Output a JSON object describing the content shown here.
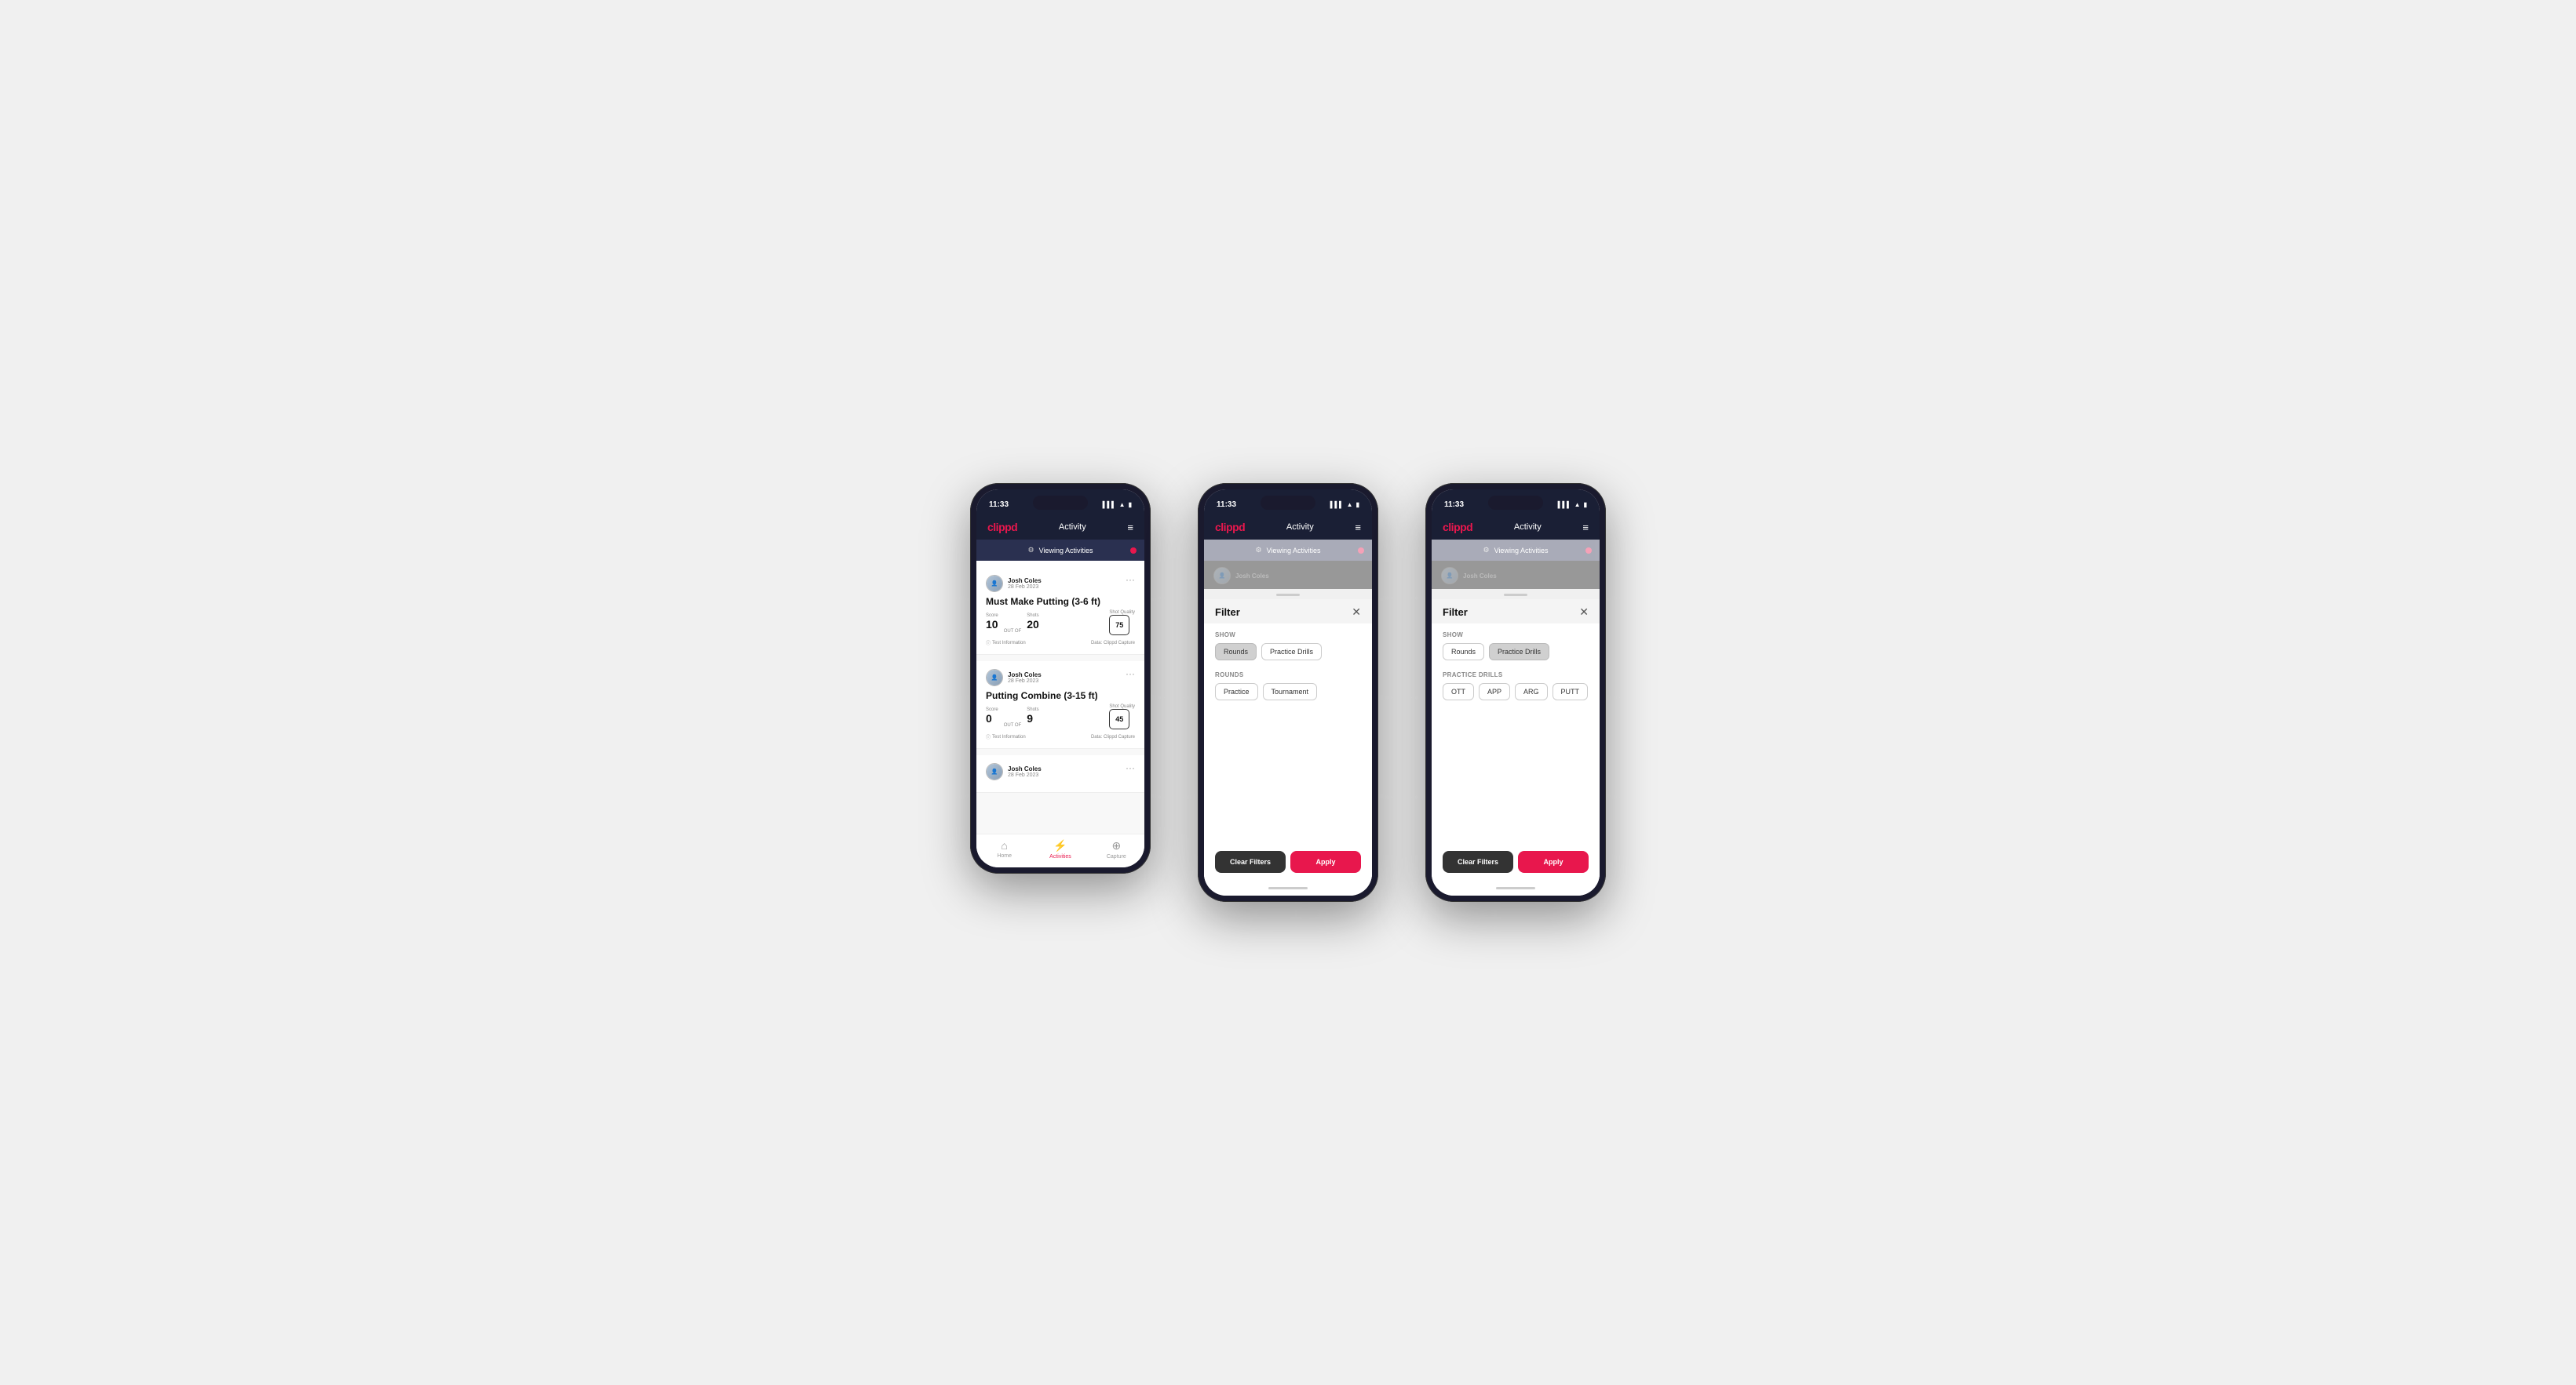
{
  "app": {
    "logo": "clippd",
    "header_title": "Activity",
    "time": "11:33",
    "viewing_bar_text": "Viewing Activities"
  },
  "phone1": {
    "type": "activity_list",
    "cards": [
      {
        "user_name": "Josh Coles",
        "user_date": "28 Feb 2023",
        "title": "Must Make Putting (3-6 ft)",
        "score_label": "Score",
        "score_value": "10",
        "shots_label": "Shots",
        "shots_value": "20",
        "shot_quality_label": "Shot Quality",
        "shot_quality_value": "75",
        "info_text": "Test Information",
        "data_text": "Data: Clippd Capture"
      },
      {
        "user_name": "Josh Coles",
        "user_date": "28 Feb 2023",
        "title": "Putting Combine (3-15 ft)",
        "score_label": "Score",
        "score_value": "0",
        "shots_label": "Shots",
        "shots_value": "9",
        "shot_quality_label": "Shot Quality",
        "shot_quality_value": "45",
        "info_text": "Test Information",
        "data_text": "Data: Clippd Capture"
      },
      {
        "user_name": "Josh Coles",
        "user_date": "28 Feb 2023",
        "title": "",
        "partial": true
      }
    ],
    "nav": [
      {
        "icon": "🏠",
        "label": "Home",
        "active": false
      },
      {
        "icon": "⚡",
        "label": "Activities",
        "active": true
      },
      {
        "icon": "➕",
        "label": "Capture",
        "active": false
      }
    ]
  },
  "phone2": {
    "type": "filter_modal",
    "filter_title": "Filter",
    "show_label": "Show",
    "show_buttons": [
      {
        "label": "Rounds",
        "active": true
      },
      {
        "label": "Practice Drills",
        "active": false
      }
    ],
    "rounds_label": "Rounds",
    "rounds_buttons": [
      {
        "label": "Practice",
        "active": false
      },
      {
        "label": "Tournament",
        "active": false
      }
    ],
    "clear_filters_label": "Clear Filters",
    "apply_label": "Apply"
  },
  "phone3": {
    "type": "filter_modal_practice",
    "filter_title": "Filter",
    "show_label": "Show",
    "show_buttons": [
      {
        "label": "Rounds",
        "active": false
      },
      {
        "label": "Practice Drills",
        "active": true
      }
    ],
    "practice_drills_label": "Practice Drills",
    "practice_drill_buttons": [
      {
        "label": "OTT",
        "active": false
      },
      {
        "label": "APP",
        "active": false
      },
      {
        "label": "ARG",
        "active": false
      },
      {
        "label": "PUTT",
        "active": false
      }
    ],
    "clear_filters_label": "Clear Filters",
    "apply_label": "Apply"
  }
}
